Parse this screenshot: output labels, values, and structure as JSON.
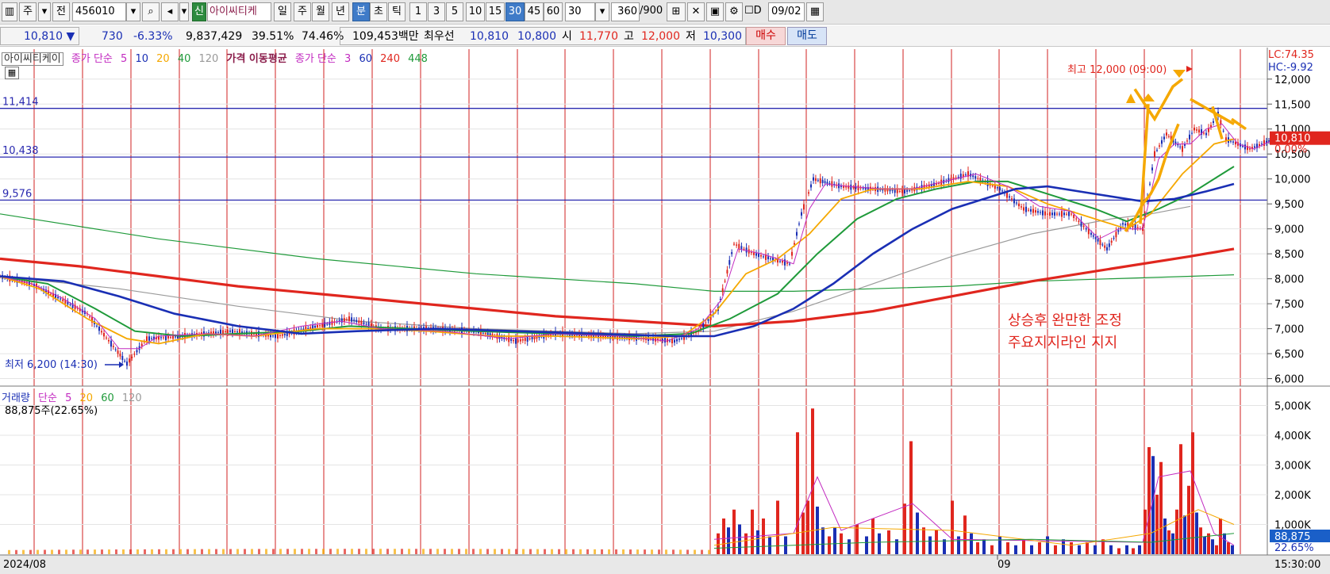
{
  "toolbar": {
    "market": "주",
    "jeon": "전",
    "code": "456010",
    "sin": "신",
    "stock_name": "아이씨티케",
    "periods": [
      "일",
      "주",
      "월",
      "년",
      "분",
      "초",
      "틱"
    ],
    "active_period": "분",
    "intervals": [
      "1",
      "3",
      "5",
      "10",
      "15",
      "30",
      "45",
      "60"
    ],
    "active_interval": "30",
    "interval_select": "30",
    "count": "360",
    "count_max": "/900",
    "date_label": "D",
    "date": "09/02"
  },
  "quote": {
    "price": "10,810",
    "arrow": "▼",
    "change": "730",
    "change_pct": "-6.33%",
    "volume": "9,837,429",
    "ratio1": "39.51%",
    "ratio2": "74.46%",
    "amount": "109,453백만",
    "bid_label": "최우선",
    "best_ask": "10,810",
    "best_bid": "10,800",
    "open_label": "시",
    "open": "11,770",
    "high_label": "고",
    "high": "12,000",
    "low_label": "저",
    "low": "10,300",
    "buy_button": "매수",
    "sell_button": "매도"
  },
  "price_legend": {
    "stock_tag": "아이씨티케이",
    "ma1_label": "종가 단순",
    "ma1_periods": [
      "5",
      "10",
      "20",
      "40",
      "120"
    ],
    "ma_title": "가격 이동평균",
    "ma2_label": "종가 단순",
    "ma2_periods": [
      "3",
      "60",
      "240",
      "448"
    ]
  },
  "volume_legend": {
    "title": "거래량",
    "ma_label": "단순",
    "periods": [
      "5",
      "20",
      "60",
      "120"
    ],
    "current": "88,875주(22.65%)"
  },
  "right_info": {
    "lc": "LC:74.35",
    "hc": "HC:-9.92"
  },
  "colors": {
    "red": "#e0261e",
    "blue": "#1a2fb4",
    "green": "#1f9a3a",
    "orange": "#f5a800",
    "magenta": "#c22ac0",
    "grid": "#d22020"
  },
  "chart_data": {
    "type": "candlestick",
    "x_labels": [
      "2024/08",
      "09"
    ],
    "time_label": "15:30:00",
    "y_axis": [
      "12,000",
      "11,500",
      "11,000",
      "10,500",
      "10,000",
      "9,500",
      "9,000",
      "8,500",
      "8,000",
      "7,500",
      "7,000",
      "6,500",
      "6,000"
    ],
    "ylim": [
      5850,
      12600
    ],
    "support_lines": [
      {
        "label": "11,414",
        "value": 11414
      },
      {
        "label": "10,438",
        "value": 10438
      },
      {
        "label": "9,576",
        "value": 9576
      }
    ],
    "current_price": {
      "label": "10,810",
      "pct": "0.00%",
      "value": 10810
    },
    "high_annotation": "최고 12,000 (09:00)",
    "low_annotation": "최저 6,200 (14:30)",
    "note_lines": [
      "상승후 완만한 조정",
      "주요지지라인 지지"
    ],
    "price_path": [
      [
        0,
        8050
      ],
      [
        40,
        7900
      ],
      [
        70,
        7650
      ],
      [
        110,
        7300
      ],
      [
        140,
        6700
      ],
      [
        160,
        6300
      ],
      [
        185,
        6800
      ],
      [
        230,
        6850
      ],
      [
        290,
        6950
      ],
      [
        350,
        6850
      ],
      [
        400,
        7050
      ],
      [
        440,
        7200
      ],
      [
        480,
        7000
      ],
      [
        540,
        7000
      ],
      [
        600,
        6950
      ],
      [
        650,
        6750
      ],
      [
        700,
        6900
      ],
      [
        760,
        6850
      ],
      [
        820,
        6800
      ],
      [
        850,
        6750
      ],
      [
        880,
        6950
      ],
      [
        905,
        7400
      ],
      [
        925,
        8700
      ],
      [
        950,
        8500
      ],
      [
        995,
        8300
      ],
      [
        1010,
        9300
      ],
      [
        1025,
        10000
      ],
      [
        1060,
        9850
      ],
      [
        1100,
        9800
      ],
      [
        1140,
        9750
      ],
      [
        1180,
        9900
      ],
      [
        1220,
        10100
      ],
      [
        1260,
        9800
      ],
      [
        1290,
        9400
      ],
      [
        1320,
        9300
      ],
      [
        1350,
        9300
      ],
      [
        1375,
        8900
      ],
      [
        1395,
        8600
      ],
      [
        1415,
        9100
      ],
      [
        1440,
        9000
      ],
      [
        1455,
        10500
      ],
      [
        1470,
        10900
      ],
      [
        1490,
        10600
      ],
      [
        1505,
        11000
      ],
      [
        1520,
        10900
      ],
      [
        1535,
        11300
      ],
      [
        1545,
        10800
      ],
      [
        1560,
        10700
      ],
      [
        1575,
        10600
      ],
      [
        1590,
        10700
      ],
      [
        1605,
        10800
      ]
    ],
    "ma_red_448": [
      [
        0,
        8400
      ],
      [
        100,
        8250
      ],
      [
        200,
        8050
      ],
      [
        300,
        7850
      ],
      [
        400,
        7700
      ],
      [
        500,
        7550
      ],
      [
        600,
        7400
      ],
      [
        700,
        7250
      ],
      [
        800,
        7150
      ],
      [
        900,
        7050
      ],
      [
        1000,
        7150
      ],
      [
        1100,
        7350
      ],
      [
        1200,
        7650
      ],
      [
        1300,
        7950
      ],
      [
        1400,
        8200
      ],
      [
        1500,
        8450
      ],
      [
        1555,
        8600
      ]
    ],
    "ma_green_240": [
      [
        0,
        9300
      ],
      [
        200,
        8800
      ],
      [
        400,
        8400
      ],
      [
        600,
        8100
      ],
      [
        800,
        7900
      ],
      [
        900,
        7750
      ],
      [
        1000,
        7750
      ],
      [
        1100,
        7800
      ],
      [
        1200,
        7850
      ],
      [
        1300,
        7950
      ],
      [
        1400,
        8000
      ],
      [
        1500,
        8050
      ],
      [
        1555,
        8080
      ]
    ],
    "ma_gray_120": [
      [
        0,
        8050
      ],
      [
        150,
        7800
      ],
      [
        300,
        7450
      ],
      [
        450,
        7150
      ],
      [
        600,
        7000
      ],
      [
        800,
        6900
      ],
      [
        900,
        6950
      ],
      [
        1000,
        7350
      ],
      [
        1100,
        7900
      ],
      [
        1200,
        8450
      ],
      [
        1300,
        8900
      ],
      [
        1400,
        9200
      ],
      [
        1450,
        9300
      ],
      [
        1500,
        9450
      ]
    ],
    "ma_blue_60": [
      [
        0,
        8050
      ],
      [
        80,
        7950
      ],
      [
        150,
        7650
      ],
      [
        220,
        7300
      ],
      [
        300,
        7050
      ],
      [
        380,
        6900
      ],
      [
        450,
        6950
      ],
      [
        550,
        7000
      ],
      [
        650,
        6950
      ],
      [
        750,
        6900
      ],
      [
        850,
        6850
      ],
      [
        900,
        6850
      ],
      [
        950,
        7050
      ],
      [
        1000,
        7400
      ],
      [
        1050,
        7900
      ],
      [
        1100,
        8500
      ],
      [
        1150,
        9000
      ],
      [
        1200,
        9400
      ],
      [
        1250,
        9650
      ],
      [
        1280,
        9800
      ],
      [
        1320,
        9850
      ],
      [
        1380,
        9700
      ],
      [
        1440,
        9550
      ],
      [
        1480,
        9600
      ],
      [
        1520,
        9750
      ],
      [
        1555,
        9900
      ]
    ],
    "ma_green_40": [
      [
        0,
        8050
      ],
      [
        60,
        7900
      ],
      [
        120,
        7400
      ],
      [
        170,
        6950
      ],
      [
        230,
        6850
      ],
      [
        300,
        6900
      ],
      [
        380,
        6950
      ],
      [
        440,
        7050
      ],
      [
        520,
        7000
      ],
      [
        600,
        6950
      ],
      [
        700,
        6900
      ],
      [
        800,
        6850
      ],
      [
        870,
        6900
      ],
      [
        920,
        7200
      ],
      [
        980,
        7700
      ],
      [
        1030,
        8500
      ],
      [
        1080,
        9200
      ],
      [
        1130,
        9600
      ],
      [
        1180,
        9800
      ],
      [
        1230,
        9950
      ],
      [
        1270,
        9950
      ],
      [
        1320,
        9700
      ],
      [
        1380,
        9400
      ],
      [
        1420,
        9150
      ],
      [
        1460,
        9400
      ],
      [
        1500,
        9700
      ],
      [
        1540,
        10100
      ],
      [
        1555,
        10250
      ]
    ],
    "ma_orange_20": [
      [
        0,
        8050
      ],
      [
        50,
        7800
      ],
      [
        110,
        7200
      ],
      [
        160,
        6800
      ],
      [
        200,
        6700
      ],
      [
        260,
        6900
      ],
      [
        320,
        6850
      ],
      [
        400,
        7000
      ],
      [
        470,
        7000
      ],
      [
        540,
        6950
      ],
      [
        620,
        6850
      ],
      [
        700,
        6850
      ],
      [
        800,
        6800
      ],
      [
        860,
        6850
      ],
      [
        900,
        7300
      ],
      [
        940,
        8100
      ],
      [
        980,
        8400
      ],
      [
        1020,
        8900
      ],
      [
        1060,
        9600
      ],
      [
        1100,
        9800
      ],
      [
        1160,
        9800
      ],
      [
        1220,
        9950
      ],
      [
        1270,
        9850
      ],
      [
        1320,
        9500
      ],
      [
        1380,
        9200
      ],
      [
        1420,
        9000
      ],
      [
        1450,
        9300
      ],
      [
        1490,
        10100
      ],
      [
        1530,
        10700
      ],
      [
        1555,
        10800
      ]
    ],
    "ma_magenta_5": [
      [
        0,
        8050
      ],
      [
        40,
        7900
      ],
      [
        80,
        7600
      ],
      [
        120,
        7200
      ],
      [
        150,
        6600
      ],
      [
        175,
        6600
      ],
      [
        200,
        6850
      ],
      [
        260,
        6900
      ],
      [
        320,
        6850
      ],
      [
        380,
        7050
      ],
      [
        430,
        7150
      ],
      [
        480,
        7000
      ],
      [
        560,
        6950
      ],
      [
        640,
        6800
      ],
      [
        700,
        6900
      ],
      [
        780,
        6850
      ],
      [
        840,
        6750
      ],
      [
        880,
        7000
      ],
      [
        910,
        7600
      ],
      [
        930,
        8600
      ],
      [
        960,
        8500
      ],
      [
        1000,
        8300
      ],
      [
        1020,
        9400
      ],
      [
        1040,
        9900
      ],
      [
        1070,
        9850
      ],
      [
        1110,
        9800
      ],
      [
        1150,
        9800
      ],
      [
        1190,
        9950
      ],
      [
        1230,
        10100
      ],
      [
        1270,
        9850
      ],
      [
        1310,
        9450
      ],
      [
        1350,
        9350
      ],
      [
        1385,
        8800
      ],
      [
        1410,
        9000
      ],
      [
        1440,
        9000
      ],
      [
        1460,
        10400
      ],
      [
        1480,
        10700
      ],
      [
        1500,
        10700
      ],
      [
        1520,
        11000
      ],
      [
        1540,
        11100
      ],
      [
        1560,
        10700
      ],
      [
        1580,
        10600
      ],
      [
        1600,
        10750
      ]
    ],
    "annotation_arrows": [
      [
        1418,
        8950
      ],
      [
        1430,
        9200
      ],
      [
        1440,
        9500
      ],
      [
        1450,
        9700
      ],
      [
        1460,
        10000
      ],
      [
        1470,
        10500
      ],
      [
        1485,
        11100
      ]
    ],
    "volume_yaxis": [
      "5,000K",
      "4,000K",
      "3,000K",
      "2,000K",
      "1,000K"
    ],
    "volume_current": {
      "label": "88,875",
      "pct": "22.65%"
    },
    "volume_max_k": 5200,
    "volume_bars": [
      {
        "x": 905,
        "v": 700,
        "c": "red"
      },
      {
        "x": 912,
        "v": 1200,
        "c": "red"
      },
      {
        "x": 918,
        "v": 900,
        "c": "blue"
      },
      {
        "x": 925,
        "v": 1500,
        "c": "red"
      },
      {
        "x": 932,
        "v": 1000,
        "c": "blue"
      },
      {
        "x": 940,
        "v": 700,
        "c": "red"
      },
      {
        "x": 948,
        "v": 1500,
        "c": "red"
      },
      {
        "x": 955,
        "v": 800,
        "c": "blue"
      },
      {
        "x": 962,
        "v": 1200,
        "c": "red"
      },
      {
        "x": 970,
        "v": 600,
        "c": "blue"
      },
      {
        "x": 980,
        "v": 1800,
        "c": "red"
      },
      {
        "x": 990,
        "v": 600,
        "c": "blue"
      },
      {
        "x": 1005,
        "v": 4100,
        "c": "red"
      },
      {
        "x": 1012,
        "v": 1400,
        "c": "red"
      },
      {
        "x": 1018,
        "v": 1800,
        "c": "red"
      },
      {
        "x": 1024,
        "v": 4900,
        "c": "red"
      },
      {
        "x": 1030,
        "v": 1600,
        "c": "blue"
      },
      {
        "x": 1037,
        "v": 900,
        "c": "blue"
      },
      {
        "x": 1045,
        "v": 600,
        "c": "red"
      },
      {
        "x": 1052,
        "v": 900,
        "c": "blue"
      },
      {
        "x": 1060,
        "v": 700,
        "c": "red"
      },
      {
        "x": 1070,
        "v": 500,
        "c": "blue"
      },
      {
        "x": 1080,
        "v": 1000,
        "c": "red"
      },
      {
        "x": 1092,
        "v": 600,
        "c": "blue"
      },
      {
        "x": 1100,
        "v": 1200,
        "c": "red"
      },
      {
        "x": 1108,
        "v": 700,
        "c": "blue"
      },
      {
        "x": 1120,
        "v": 800,
        "c": "red"
      },
      {
        "x": 1130,
        "v": 500,
        "c": "blue"
      },
      {
        "x": 1140,
        "v": 1700,
        "c": "red"
      },
      {
        "x": 1148,
        "v": 3800,
        "c": "red"
      },
      {
        "x": 1156,
        "v": 1400,
        "c": "blue"
      },
      {
        "x": 1164,
        "v": 900,
        "c": "red"
      },
      {
        "x": 1172,
        "v": 600,
        "c": "blue"
      },
      {
        "x": 1180,
        "v": 800,
        "c": "red"
      },
      {
        "x": 1190,
        "v": 500,
        "c": "blue"
      },
      {
        "x": 1200,
        "v": 1800,
        "c": "red"
      },
      {
        "x": 1208,
        "v": 600,
        "c": "blue"
      },
      {
        "x": 1216,
        "v": 1300,
        "c": "red"
      },
      {
        "x": 1224,
        "v": 700,
        "c": "blue"
      },
      {
        "x": 1232,
        "v": 400,
        "c": "red"
      },
      {
        "x": 1240,
        "v": 500,
        "c": "blue"
      },
      {
        "x": 1250,
        "v": 300,
        "c": "red"
      },
      {
        "x": 1260,
        "v": 600,
        "c": "blue"
      },
      {
        "x": 1270,
        "v": 400,
        "c": "red"
      },
      {
        "x": 1280,
        "v": 300,
        "c": "blue"
      },
      {
        "x": 1290,
        "v": 500,
        "c": "red"
      },
      {
        "x": 1300,
        "v": 300,
        "c": "blue"
      },
      {
        "x": 1310,
        "v": 400,
        "c": "red"
      },
      {
        "x": 1320,
        "v": 600,
        "c": "blue"
      },
      {
        "x": 1330,
        "v": 300,
        "c": "red"
      },
      {
        "x": 1340,
        "v": 500,
        "c": "blue"
      },
      {
        "x": 1350,
        "v": 400,
        "c": "red"
      },
      {
        "x": 1360,
        "v": 300,
        "c": "blue"
      },
      {
        "x": 1370,
        "v": 400,
        "c": "red"
      },
      {
        "x": 1380,
        "v": 300,
        "c": "blue"
      },
      {
        "x": 1390,
        "v": 500,
        "c": "red"
      },
      {
        "x": 1400,
        "v": 300,
        "c": "blue"
      },
      {
        "x": 1410,
        "v": 200,
        "c": "red"
      },
      {
        "x": 1420,
        "v": 300,
        "c": "blue"
      },
      {
        "x": 1428,
        "v": 200,
        "c": "red"
      },
      {
        "x": 1436,
        "v": 300,
        "c": "blue"
      },
      {
        "x": 1443,
        "v": 1500,
        "c": "red"
      },
      {
        "x": 1448,
        "v": 3600,
        "c": "red"
      },
      {
        "x": 1453,
        "v": 3300,
        "c": "blue"
      },
      {
        "x": 1458,
        "v": 2000,
        "c": "red"
      },
      {
        "x": 1463,
        "v": 3100,
        "c": "red"
      },
      {
        "x": 1468,
        "v": 1200,
        "c": "blue"
      },
      {
        "x": 1473,
        "v": 800,
        "c": "red"
      },
      {
        "x": 1478,
        "v": 700,
        "c": "blue"
      },
      {
        "x": 1483,
        "v": 1500,
        "c": "red"
      },
      {
        "x": 1488,
        "v": 3700,
        "c": "red"
      },
      {
        "x": 1493,
        "v": 1300,
        "c": "blue"
      },
      {
        "x": 1498,
        "v": 2300,
        "c": "red"
      },
      {
        "x": 1503,
        "v": 4100,
        "c": "red"
      },
      {
        "x": 1508,
        "v": 1400,
        "c": "blue"
      },
      {
        "x": 1513,
        "v": 900,
        "c": "red"
      },
      {
        "x": 1518,
        "v": 600,
        "c": "blue"
      },
      {
        "x": 1523,
        "v": 700,
        "c": "red"
      },
      {
        "x": 1528,
        "v": 500,
        "c": "blue"
      },
      {
        "x": 1533,
        "v": 300,
        "c": "red"
      },
      {
        "x": 1538,
        "v": 1200,
        "c": "red"
      },
      {
        "x": 1543,
        "v": 700,
        "c": "blue"
      },
      {
        "x": 1548,
        "v": 400,
        "c": "red"
      },
      {
        "x": 1553,
        "v": 300,
        "c": "blue"
      }
    ]
  }
}
